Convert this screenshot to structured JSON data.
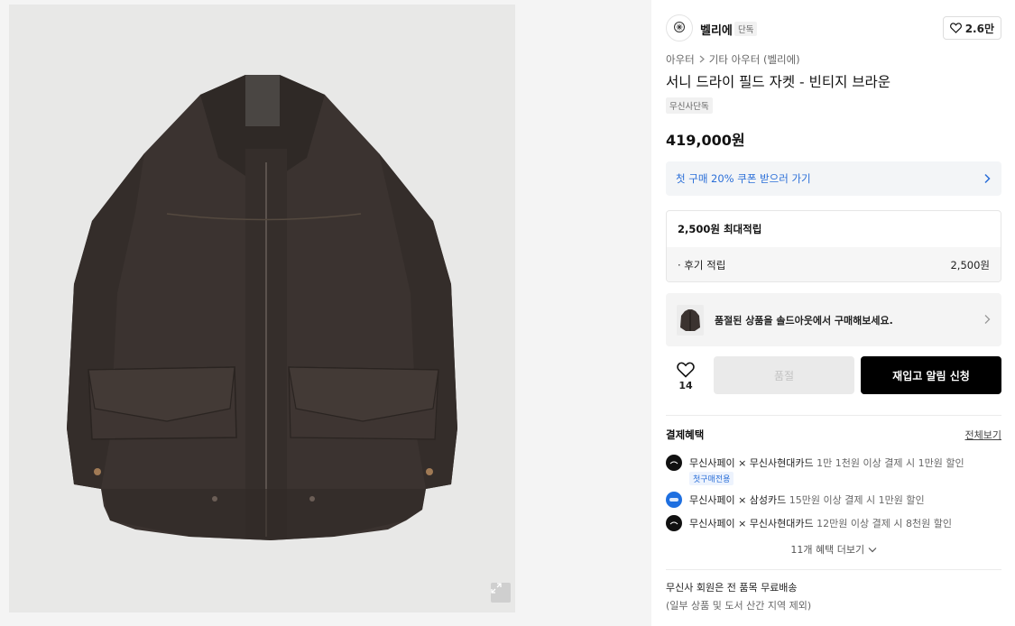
{
  "product": {
    "image_alt_icon": "expand-icon"
  },
  "brand": {
    "name": "벨리에",
    "tag": "단독",
    "like_count": "2.6만"
  },
  "breadcrumb": {
    "category": "아우터",
    "subcategory": "기타 아우터 (벨리에)"
  },
  "title": "서니 드라이 필드 자켓 - 빈티지 브라운",
  "exclusive_tag": "무신사단독",
  "price": "419,000원",
  "coupon": {
    "text": "첫 구매 20% 쿠폰 받으러 가기"
  },
  "points": {
    "heading": "2,500원 최대적립",
    "row_label": "· 후기 적립",
    "row_value": "2,500원"
  },
  "soldout_banner": {
    "text": "품절된 상품을 솔드아웃에서 구매해보세요."
  },
  "actions": {
    "wish_count": "14",
    "soldout_label": "품절",
    "restock_label": "재입고 알림 신청"
  },
  "benefits": {
    "heading": "결제혜택",
    "view_all": "전체보기",
    "items": [
      {
        "provider": "무신사페이 × 무신사현대카드",
        "detail": "1만 1천원 이상 결제 시 1만원 할인",
        "tag": "첫구매전용",
        "icon": "hyundai-card-icon",
        "color": "#111111"
      },
      {
        "provider": "무신사페이 × 삼성카드",
        "detail": "15만원 이상 결제 시 1만원 할인",
        "tag": "",
        "icon": "samsung-card-icon",
        "color": "#1e6fe0"
      },
      {
        "provider": "무신사페이 × 무신사현대카드",
        "detail": "12만원 이상 결제 시 8천원 할인",
        "tag": "",
        "icon": "hyundai-card-icon",
        "color": "#111111"
      }
    ],
    "more": "11개 혜택 더보기"
  },
  "shipping": {
    "line1": "무신사 회원은 전 품목 무료배송",
    "line2": "(일부 상품 및 도서 산간 지역 제외)"
  },
  "colors": {
    "accent_blue": "#2b6fd8",
    "primary_button": "#000000",
    "disabled_button": "#eaeaea"
  }
}
